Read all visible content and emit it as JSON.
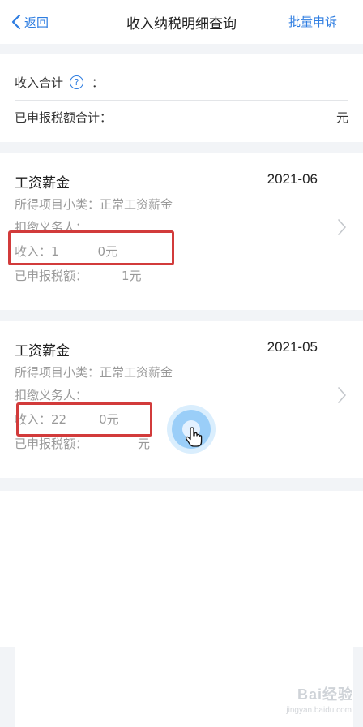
{
  "header": {
    "back_label": "返回",
    "title": "收入纳税明细查询",
    "action_label": "批量申诉"
  },
  "summary": {
    "income_total_label": "收入合计",
    "help_glyph": "?",
    "income_total_colon": "：",
    "declared_tax_total_label": "已申报税额合计：",
    "declared_tax_total_unit": "元"
  },
  "records": [
    {
      "category": "工资薪金",
      "period": "2021-06",
      "subcategory_line": "所得项目小类：正常工资薪金",
      "withholder_line": "扣缴义务人：",
      "income_line": "收入：1",
      "income_unit_partial": "0元",
      "tax_line": "已申报税额：",
      "tax_unit_partial": "1元"
    },
    {
      "category": "工资薪金",
      "period": "2021-05",
      "subcategory_line": "所得项目小类：正常工资薪金",
      "withholder_line": "扣缴义务人：",
      "income_line": "收入：22",
      "income_unit_partial": "0元",
      "tax_line": "已申报税额：",
      "tax_unit_partial": "元"
    }
  ],
  "watermark": {
    "brand": "Bai经验",
    "url": "jingyan.baidu.com"
  },
  "colors": {
    "accent": "#2e7de1",
    "highlight": "#d23b3b",
    "background": "#f2f4f7"
  }
}
